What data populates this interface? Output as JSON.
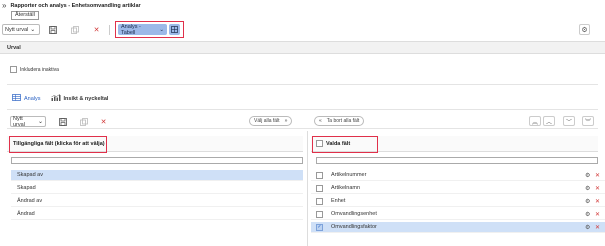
{
  "breadcrumb": "Rapporter och analys - Enhetsomvandling artiklar",
  "tooltip": "Återställ",
  "toolbar": {
    "selection_label": "Nytt urval",
    "view_label": "Analys - Tabell",
    "highlight_color": "#e0304a",
    "view_color": "#9cb9e8"
  },
  "urval": {
    "header": "Urval",
    "include_inactive": "Inkludera inaktiva"
  },
  "tabs": {
    "analysis": "Analys",
    "insight": "Insikt & nyckeltal"
  },
  "toolbar2": {
    "selection_label": "Nytt urval",
    "select_all": "Välj alla fält",
    "remove_all": "Ta bort alla fält"
  },
  "available": {
    "header": "Tillgängliga fält (klicka för att välja)",
    "filter_value": "",
    "items": [
      "Skapad av",
      "Skapad",
      "Ändrad av",
      "Ändrad"
    ]
  },
  "selected": {
    "header": "Valda fält",
    "filter_value": "",
    "items": [
      "Artikelnummer",
      "Artikelnamn",
      "Enhet",
      "Omvandlingsenhet",
      "Omvandlingsfaktor"
    ]
  }
}
